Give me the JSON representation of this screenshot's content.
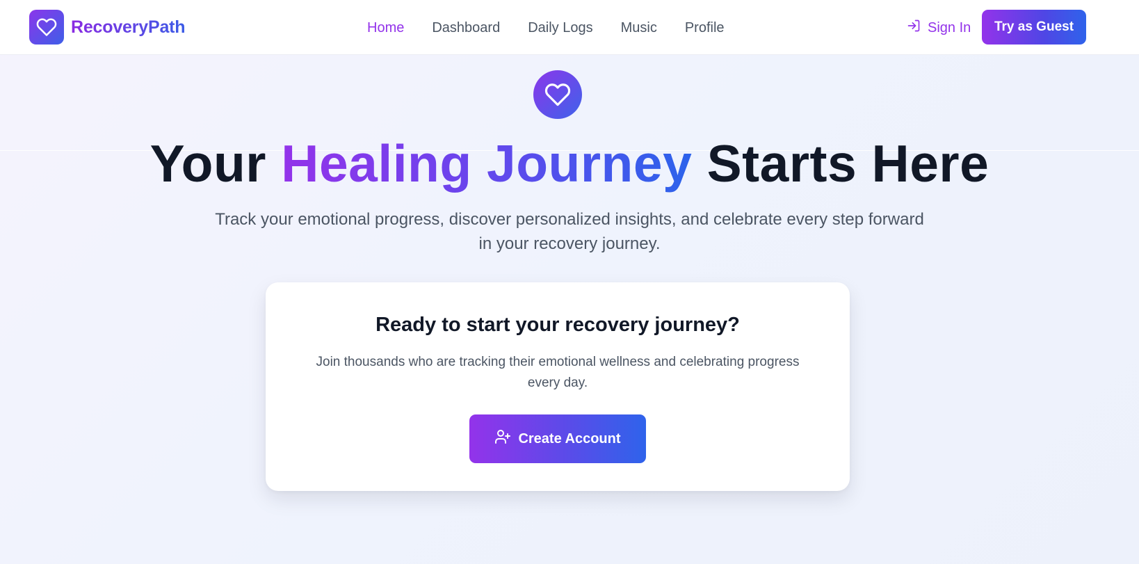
{
  "brand": {
    "name": "RecoveryPath",
    "icon": "heart-icon"
  },
  "nav": {
    "items": [
      {
        "label": "Home",
        "active": true
      },
      {
        "label": "Dashboard",
        "active": false
      },
      {
        "label": "Daily Logs",
        "active": false
      },
      {
        "label": "Music",
        "active": false
      },
      {
        "label": "Profile",
        "active": false
      }
    ],
    "sign_in": {
      "label": "Sign In",
      "icon": "sign-in-icon"
    },
    "guest_button": "Try as Guest"
  },
  "hero": {
    "icon": "heart-icon",
    "title_start": "Your",
    "title_highlight": "Healing Journey",
    "title_end": "Starts Here",
    "subtitle": "Track your emotional progress, discover personalized insights, and celebrate every step forward in your recovery journey."
  },
  "cta": {
    "title": "Ready to start your recovery journey?",
    "text": "Join thousands who are tracking their emotional wellness and celebrating progress every day.",
    "button": {
      "label": "Create Account",
      "icon": "user-plus-icon"
    }
  },
  "colors": {
    "accent_purple": "#9333ea",
    "accent_blue": "#2f63eb",
    "text_dark": "#111827",
    "text_muted": "#4b5563",
    "background": "#f1f2fc"
  }
}
